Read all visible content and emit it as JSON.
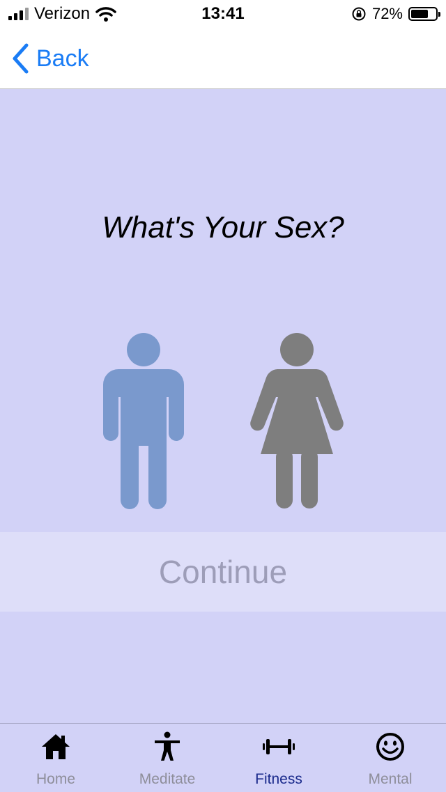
{
  "status_bar": {
    "carrier": "Verizon",
    "time": "13:41",
    "battery_percent": "72%",
    "battery_level": 0.72
  },
  "nav": {
    "back_label": "Back",
    "accent_color": "#1a7cf5"
  },
  "main": {
    "question": "What's Your Sex?",
    "options": [
      {
        "name": "male",
        "icon": "male-figure-icon",
        "color": "#7a99cd"
      },
      {
        "name": "female",
        "icon": "female-figure-icon",
        "color": "#7e7e7e"
      }
    ],
    "continue_label": "Continue"
  },
  "tab_bar": {
    "tabs": [
      {
        "label": "Home",
        "icon": "house-icon",
        "active": false
      },
      {
        "label": "Meditate",
        "icon": "person-icon",
        "active": false
      },
      {
        "label": "Fitness",
        "icon": "dumbbell-icon",
        "active": true
      },
      {
        "label": "Mental",
        "icon": "smiley-icon",
        "active": false
      }
    ]
  }
}
